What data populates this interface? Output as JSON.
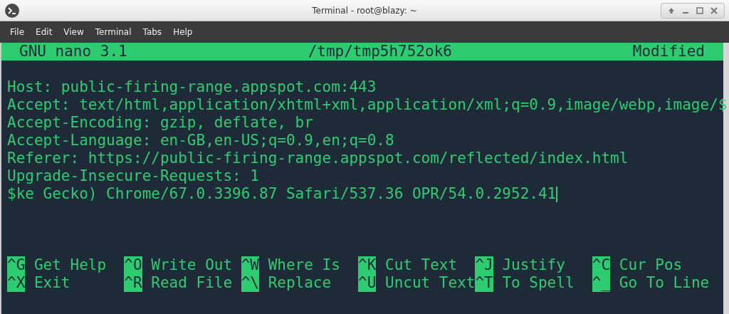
{
  "window": {
    "title": "Terminal - root@blazy: ~"
  },
  "menu": [
    "File",
    "Edit",
    "View",
    "Terminal",
    "Tabs",
    "Help"
  ],
  "nano_header": {
    "version": "GNU nano 3.1",
    "filename": "/tmp/tmp5h752ok6",
    "status": "Modified"
  },
  "lines": [
    "Host: public-firing-range.appspot.com:443",
    "Accept: text/html,application/xhtml+xml,application/xml;q=0.9,image/webp,image/$",
    "Accept-Encoding: gzip, deflate, br",
    "Accept-Language: en-GB,en-US;q=0.9,en;q=0.8",
    "Referer: https://public-firing-range.appspot.com/reflected/index.html",
    "Upgrade-Insecure-Requests: 1",
    "$ke Gecko) Chrome/67.0.3396.87 Safari/537.36 OPR/54.0.2952.41"
  ],
  "shortcuts": [
    [
      {
        "key": "^G",
        "label": "Get Help"
      },
      {
        "key": "^O",
        "label": "Write Out"
      },
      {
        "key": "^W",
        "label": "Where Is"
      },
      {
        "key": "^K",
        "label": "Cut Text"
      },
      {
        "key": "^J",
        "label": "Justify"
      },
      {
        "key": "^C",
        "label": "Cur Pos"
      }
    ],
    [
      {
        "key": "^X",
        "label": "Exit"
      },
      {
        "key": "^R",
        "label": "Read File"
      },
      {
        "key": "^\\",
        "label": "Replace"
      },
      {
        "key": "^U",
        "label": "Uncut Text"
      },
      {
        "key": "^T",
        "label": "To Spell"
      },
      {
        "key": "^_",
        "label": "Go To Line"
      }
    ]
  ]
}
